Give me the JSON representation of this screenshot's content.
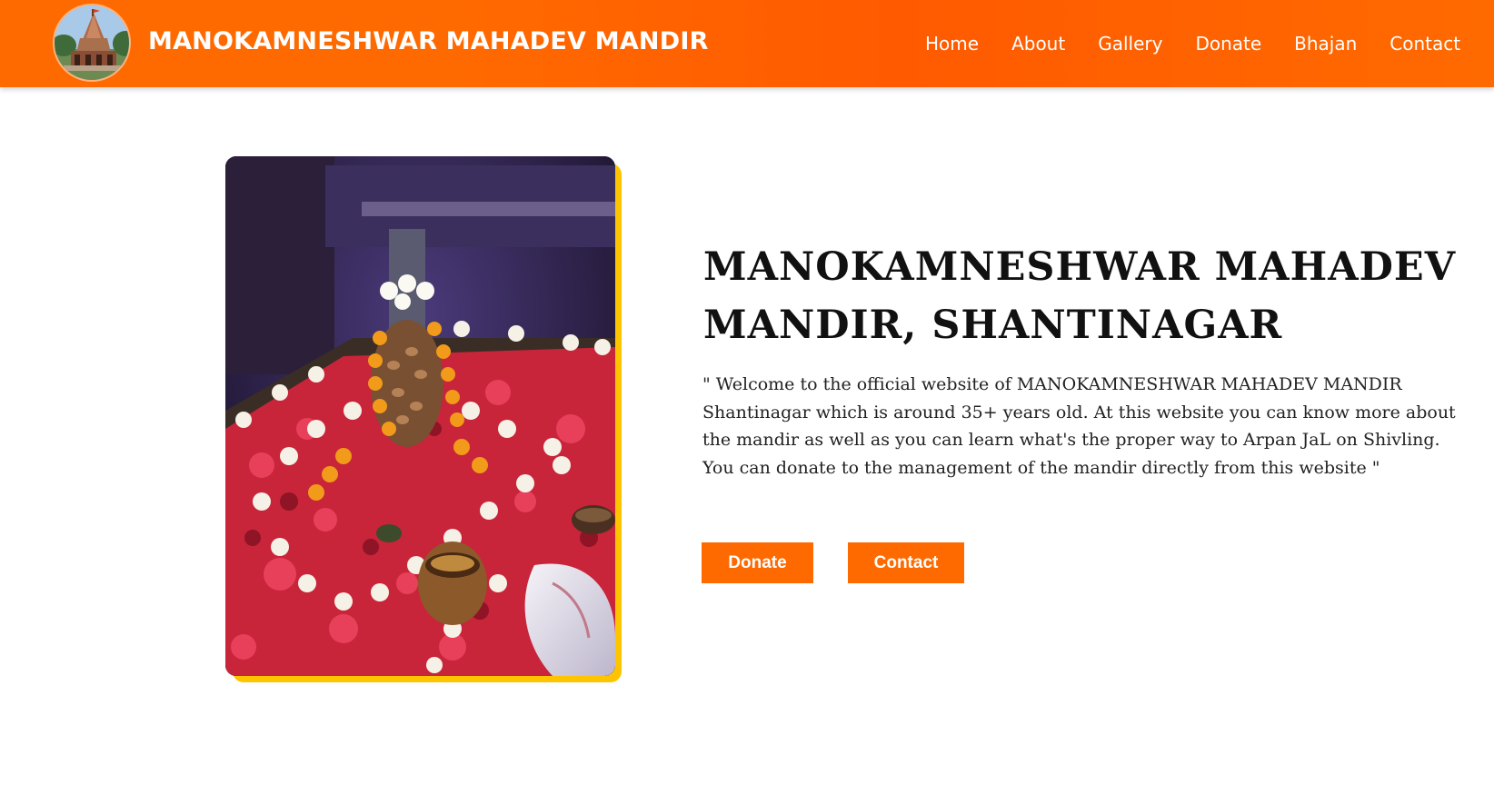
{
  "header": {
    "title": "MANOKAMNESHWAR MAHADEV MANDIR",
    "nav": [
      "Home",
      "About",
      "Gallery",
      "Donate",
      "Bhajan",
      "Contact"
    ]
  },
  "hero": {
    "heading": "MANOKAMNESHWAR MAHADEV MANDIR, SHANTINAGAR",
    "paragraph_1": "\" Welcome to the official website of MANOKAMNESHWAR MAHADEV MANDIR Shantinagar which is around 35+ years old. At this website you can know more about the mandir as well as you can learn what's the proper way to Arpan JaL on Shivling.",
    "paragraph_2": "You can donate to the management of the mandir directly from this website \"",
    "donate_label": "Donate",
    "contact_label": "Contact"
  },
  "colors": {
    "header_bg": "#ff6a00",
    "button_bg": "#ff6a00",
    "image_accent": "#ffc400"
  }
}
